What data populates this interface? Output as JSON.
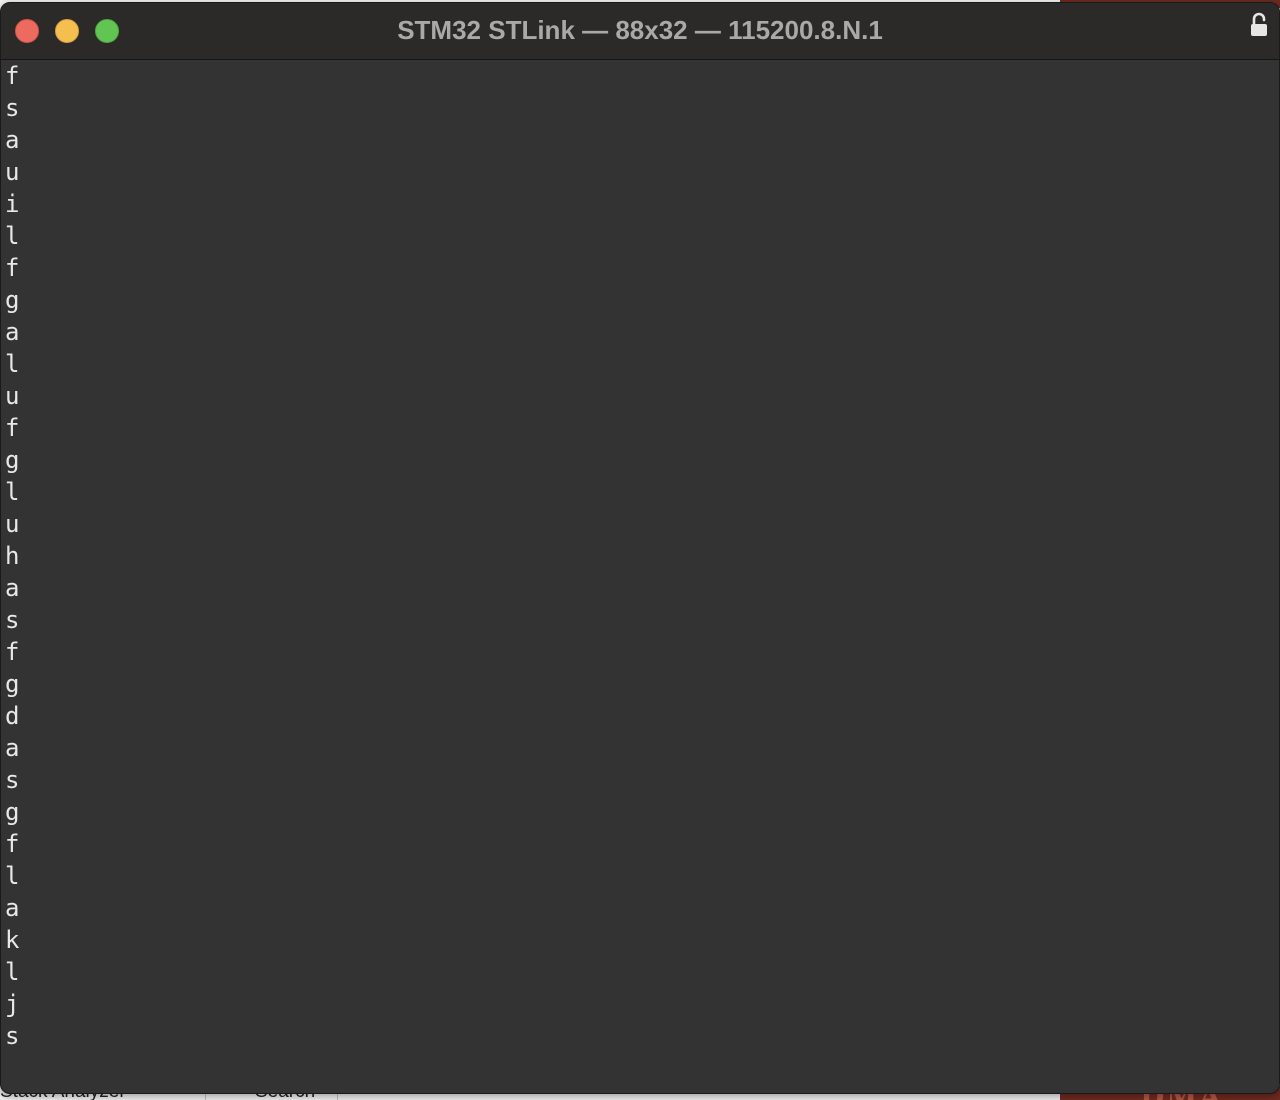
{
  "window": {
    "title": "STM32 STLink — 88x32 — 115200.8.N.1"
  },
  "terminal": {
    "lines": [
      "f",
      "s",
      "a",
      "u",
      "i",
      "l",
      "f",
      "g",
      "a",
      "l",
      "u",
      "f",
      "g",
      "l",
      "u",
      "h",
      "a",
      "s",
      "f",
      "g",
      "d",
      "a",
      "s",
      "g",
      "f",
      "l",
      "a",
      "k",
      "l",
      "j",
      "s"
    ]
  },
  "background": {
    "app_labels": [
      "Stack Analyzer",
      "Search"
    ],
    "desktop_text": "DMA"
  },
  "colors": {
    "terminal_bg": "#333333",
    "titlebar_bg": "#2c2a29",
    "title_text": "#a9a9a9",
    "terminal_text": "#e8e8e8",
    "close": "#ed6a5e",
    "minimize": "#f4bf4f",
    "zoom": "#61c554"
  },
  "icons": {
    "lock": "lock-icon"
  }
}
